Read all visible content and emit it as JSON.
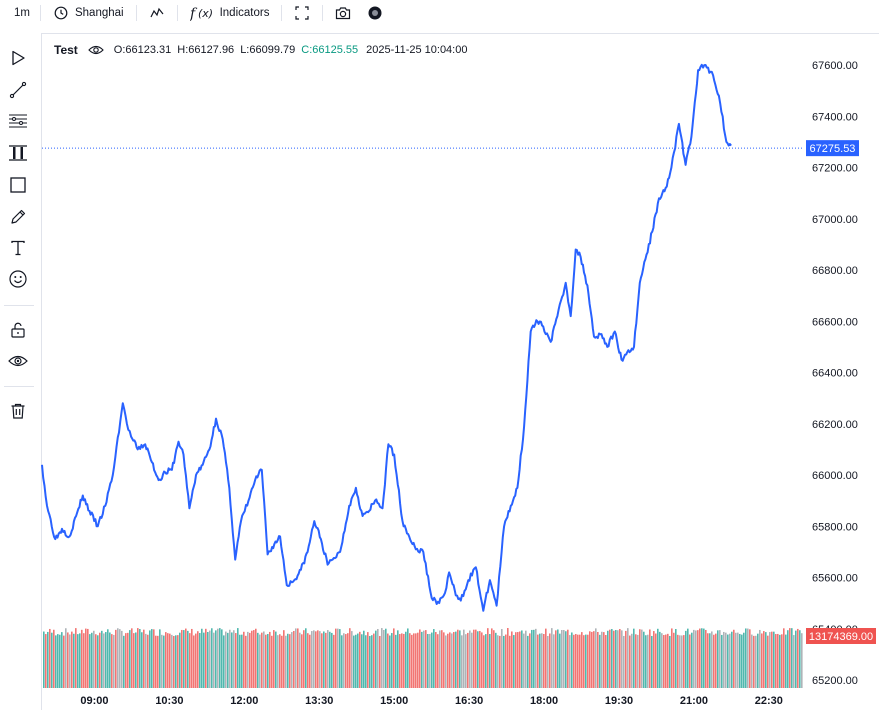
{
  "toolbar": {
    "interval": "1m",
    "timezone": "Shanghai",
    "indicators_label": "Indicators",
    "icons": [
      "clock-icon",
      "line-style-icon",
      "function-icon",
      "fullscreen-icon",
      "camera-icon",
      "settings-dot-icon"
    ]
  },
  "sidebar": {
    "tools": [
      "cursor-arrow-icon",
      "trend-line-icon",
      "fib-retracement-icon",
      "channel-icon",
      "rectangle-icon",
      "pencil-icon",
      "text-icon",
      "emoji-icon",
      "lock-icon",
      "eye-icon",
      "trash-icon"
    ]
  },
  "legend": {
    "symbol": "Test",
    "open": "O:66123.31",
    "high": "H:66127.96",
    "low": "L:66099.79",
    "close": "C:66125.55",
    "timestamp": "2025-11-25 10:04:00"
  },
  "colors": {
    "line": "#2962ff",
    "up": "#26a69a",
    "down": "#ef5350",
    "price_label_bg": "#2962ff",
    "volume_label_bg": "#ef5350",
    "close_text": "#089981"
  },
  "chart_data": {
    "type": "line",
    "x_tick_labels": [
      "09:00",
      "10:30",
      "12:00",
      "13:30",
      "15:00",
      "16:30",
      "18:00",
      "19:30",
      "21:00",
      "22:30"
    ],
    "y_tick_labels": [
      "67600.00",
      "67400.00",
      "67200.00",
      "67000.00",
      "66800.00",
      "66600.00",
      "66400.00",
      "66200.00",
      "66000.00",
      "65800.00",
      "65600.00",
      "65400.00",
      "65200.00"
    ],
    "ylim": [
      65200,
      67600
    ],
    "last_price_label": "67275.53",
    "last_price": 67275.53,
    "volume_label": "13174369.00",
    "x_start": "07:57",
    "x_end": "23:11",
    "series": [
      {
        "time": [
          "07:57",
          "08:03",
          "08:13",
          "08:21",
          "08:30",
          "08:38",
          "08:46",
          "08:54",
          "09:04",
          "09:13",
          "09:22",
          "09:34",
          "09:39",
          "09:44",
          "09:52",
          "10:01",
          "10:09",
          "10:17",
          "10:25",
          "10:33",
          "10:41",
          "10:47",
          "10:54",
          "11:02",
          "11:10",
          "11:18",
          "11:26",
          "11:34",
          "11:42",
          "11:49",
          "11:56",
          "12:05",
          "12:13",
          "12:21",
          "12:28",
          "12:36",
          "12:43",
          "12:51",
          "13:00",
          "13:08",
          "13:16",
          "13:24",
          "13:32",
          "13:40",
          "13:46",
          "13:55",
          "14:06",
          "14:14",
          "14:22",
          "14:30",
          "14:37",
          "14:46",
          "14:53",
          "15:00",
          "15:10",
          "15:18",
          "15:26",
          "15:35",
          "15:45",
          "15:54",
          "16:01",
          "16:06",
          "16:14",
          "16:20",
          "16:29",
          "16:38",
          "16:47",
          "16:55",
          "17:03",
          "17:12",
          "17:20",
          "17:28",
          "17:36",
          "17:44",
          "17:52",
          "17:59",
          "18:08",
          "18:16",
          "18:26",
          "18:32",
          "18:38",
          "18:44",
          "18:52",
          "19:00",
          "19:09",
          "19:16",
          "19:25",
          "19:33",
          "19:40",
          "19:48",
          "19:55",
          "20:03",
          "20:10",
          "20:18",
          "20:26",
          "20:33",
          "20:42",
          "20:50",
          "20:57",
          "21:05",
          "21:14",
          "21:23",
          "21:30",
          "21:39",
          "21:46",
          "21:53",
          "22:01",
          "22:09",
          "22:18",
          "22:27",
          "22:32",
          "22:38",
          "22:44",
          "22:50",
          "22:57",
          "23:04",
          "23:11"
        ],
        "values": [
          66040,
          65880,
          65750,
          65790,
          65760,
          65840,
          65920,
          65860,
          65800,
          65880,
          66000,
          66280,
          66200,
          66150,
          66100,
          66120,
          66050,
          65980,
          66010,
          66020,
          66130,
          66080,
          65870,
          66000,
          66040,
          66100,
          66220,
          66140,
          65950,
          65670,
          65820,
          65900,
          65980,
          66020,
          65690,
          65730,
          65760,
          65570,
          65590,
          65630,
          65700,
          65820,
          65750,
          65650,
          65670,
          65700,
          65880,
          65950,
          65840,
          65860,
          65900,
          65870,
          66120,
          66080,
          65820,
          65760,
          65710,
          65700,
          65520,
          65500,
          65540,
          65620,
          65530,
          65510,
          65590,
          65640,
          65470,
          65590,
          65490,
          65800,
          65880,
          65950,
          66190,
          66560,
          66600,
          66580,
          66520,
          66620,
          66750,
          66620,
          66880,
          66850,
          66740,
          66540,
          66550,
          66500,
          66560,
          66450,
          66480,
          66500,
          66750,
          66860,
          66950,
          67080,
          67120,
          67200,
          67370,
          67210,
          67320,
          67580,
          67600,
          67560,
          67480,
          67300,
          67275
        ]
      }
    ]
  }
}
